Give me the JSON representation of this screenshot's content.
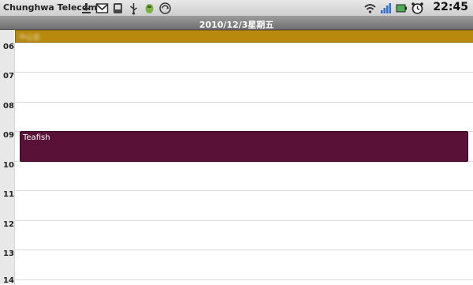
{
  "status_bar": {
    "carrier": "Chunghwa Telecom",
    "time": "22:45",
    "notification_icons": [
      "download-icon",
      "gmail-icon",
      "android-icon",
      "usb-icon",
      "android-debug-icon",
      "sync-icon"
    ],
    "system_icons": [
      "wifi-icon",
      "signal-icon",
      "battery-icon",
      "alarm-icon"
    ]
  },
  "calendar": {
    "date_title": "2010/12/3星期五",
    "all_day_event": {
      "title": "中山会",
      "color": "#b8890d"
    },
    "hours": [
      "06",
      "07",
      "08",
      "09",
      "10",
      "11",
      "12",
      "13",
      "14"
    ],
    "events": [
      {
        "title": "Teafish",
        "color": "#5a1137"
      }
    ]
  }
}
